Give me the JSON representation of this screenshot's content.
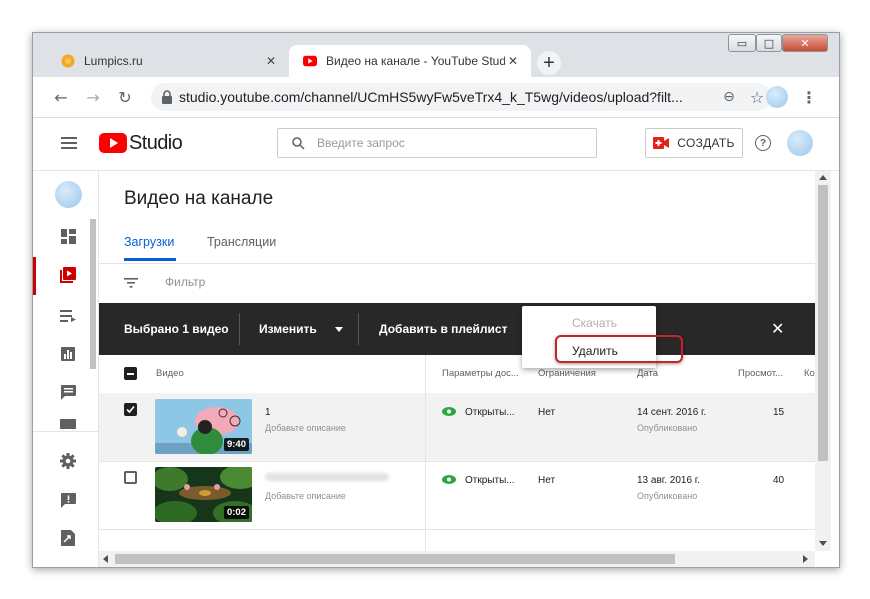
{
  "browser": {
    "tabs": [
      {
        "title": "Lumpics.ru",
        "close": "✕",
        "favicon": "orange-circle-icon"
      },
      {
        "title": "Видео на канале - YouTube Studio",
        "close": "✕",
        "favicon": "youtube-icon"
      }
    ],
    "new_tab": "+",
    "window_buttons": {
      "minimize": "▭",
      "maximize": "□",
      "close": "✕"
    },
    "url": "studio.youtube.com/channel/UCmHS5wyFw5veTrx4_k_T5wg/videos/upload?filt...",
    "nav": {
      "back": "←",
      "forward": "→",
      "reload": "↻",
      "zoom": "⊖",
      "star": "☆",
      "menu": "⋮"
    }
  },
  "header": {
    "logo_text": "Studio",
    "search_placeholder": "Введите запрос",
    "create_label": "СОЗДАТЬ",
    "help": "?"
  },
  "main": {
    "title": "Видео на канале",
    "tabs": [
      "Загрузки",
      "Трансляции"
    ],
    "filter_label": "Фильтр",
    "action_bar": {
      "selected": "Выбрано 1 видео",
      "edit": "Изменить",
      "add_playlist": "Добавить в плейлист",
      "close": "✕"
    },
    "dropdown": {
      "download": "Скачать",
      "delete": "Удалить"
    },
    "columns": [
      "Видео",
      "Параметры дос...",
      "Ограничения",
      "Дата",
      "Просмот...",
      "Ко"
    ],
    "rows": [
      {
        "title": "1",
        "description": "Добавьте описание",
        "duration": "9:40",
        "visibility": "Открыты...",
        "restrictions": "Нет",
        "date": "14 сент. 2016 г.",
        "date_status": "Опубликовано",
        "views": "15",
        "checked": true
      },
      {
        "title": "",
        "description": "Добавьте описание",
        "duration": "0:02",
        "visibility": "Открыты...",
        "restrictions": "Нет",
        "date": "13 авг. 2016 г.",
        "date_status": "Опубликовано",
        "views": "40",
        "checked": false
      }
    ]
  },
  "colors": {
    "accent": "#065fd4",
    "yt_red": "#ff0000",
    "action_bar": "#282828",
    "highlight": "#c8232a"
  }
}
